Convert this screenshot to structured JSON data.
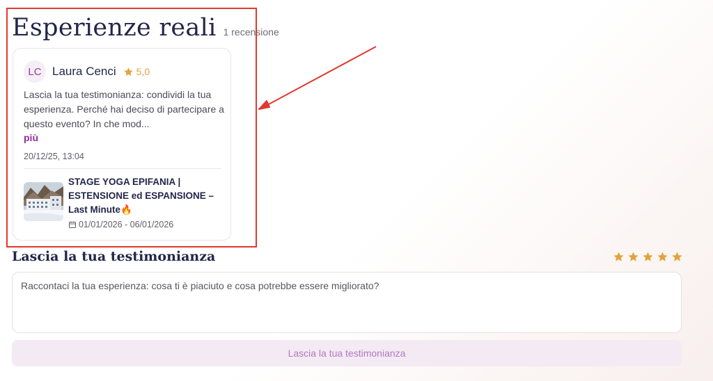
{
  "section": {
    "title": "Esperienze reali",
    "review_count": "1 recensione"
  },
  "review": {
    "avatar_initials": "LC",
    "name": "Laura Cenci",
    "rating": "5,0",
    "text": "Lascia la tua testimonianza: condividi la tua esperienza. Perché hai deciso di partecipare a questo evento? In che mod...",
    "more_label": "più",
    "date": "20/12/25, 13:04",
    "event": {
      "title": "STAGE YOGA EPIFANIA | ESTENSIONE ed ESPANSIONE – Last Minute🔥",
      "dates": "01/01/2026 - 06/01/2026"
    }
  },
  "form": {
    "title": "Lascia la tua testimonianza",
    "star_count": 5,
    "placeholder": "Raccontaci la tua esperienza: cosa ti è piaciuto e cosa potrebbe essere migliorato?",
    "submit_label": "Lascia la tua testimonianza"
  },
  "colors": {
    "accent": "#8e2f9b",
    "star": "#e2a33a",
    "annotation": "#e0392f"
  }
}
